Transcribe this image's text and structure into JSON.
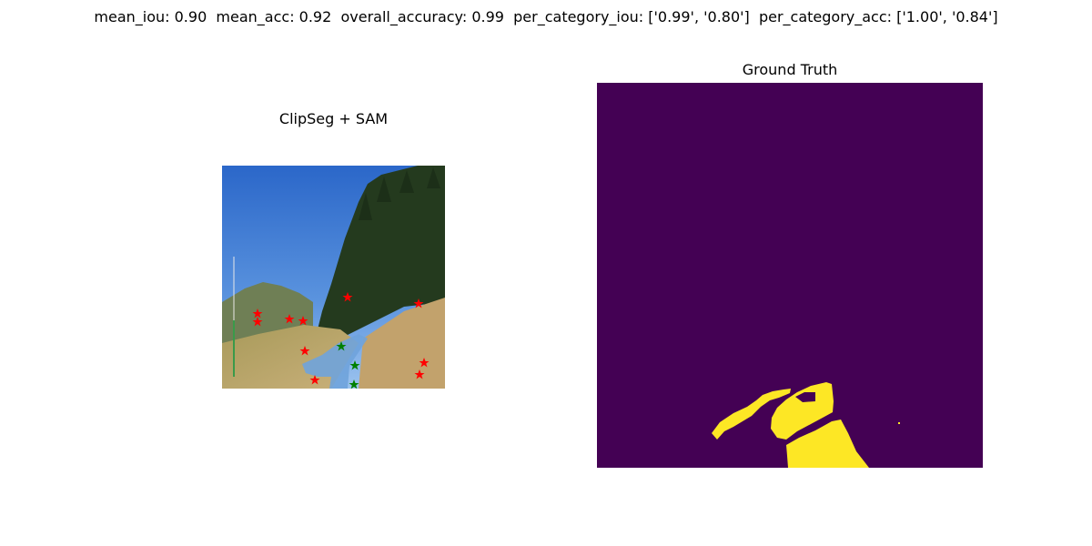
{
  "suptitle": "mean_iou: 0.90  mean_acc: 0.92  overall_accuracy: 0.99  per_category_iou: ['0.99', '0.80']  per_category_acc: ['1.00', '0.84']",
  "panels": {
    "left": {
      "title": "ClipSeg + SAM"
    },
    "right": {
      "title": "Ground Truth"
    }
  },
  "colors": {
    "mask_background": "#440154",
    "mask_foreground": "#fde725",
    "negative_point": "#ff0000",
    "positive_point": "#008000",
    "water_overlay": "#6fa3dc"
  },
  "icons": {
    "negative_point": "star-icon",
    "positive_point": "star-icon"
  }
}
